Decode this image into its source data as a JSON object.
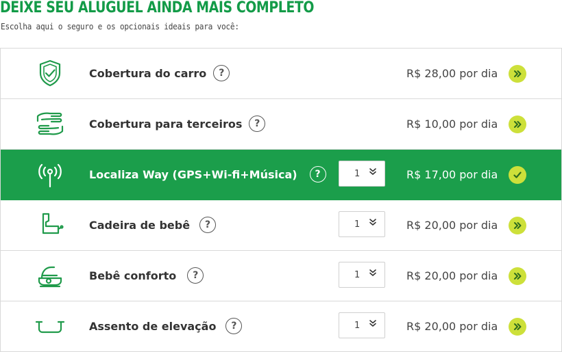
{
  "heading": "DEIXE SEU ALUGUEL AINDA MAIS COMPLETO",
  "subheading": "Escolha aqui o seguro e os opcionais ideais para você:",
  "colors": {
    "brand_green": "#139b48",
    "selected_row": "#1b9e4b",
    "action_button": "#cde03a"
  },
  "help_symbol": "?",
  "options": [
    {
      "icon": "shield-check-icon",
      "label": "Cobertura do carro",
      "price": "R$ 28,00 por dia",
      "selected": false,
      "action_icon": "double-chevron-right-icon"
    },
    {
      "icon": "hands-icon",
      "label": "Cobertura para terceiros",
      "price": "R$ 10,00 por dia",
      "selected": false,
      "action_icon": "double-chevron-right-icon"
    },
    {
      "icon": "wifi-antenna-icon",
      "label": "Localiza Way (GPS+Wi-fi+Música)",
      "quantity": "1",
      "price": "R$ 17,00 por dia",
      "selected": true,
      "action_icon": "checkmark-icon"
    },
    {
      "icon": "baby-seat-icon",
      "label": "Cadeira de bebê",
      "quantity": "1",
      "price": "R$ 20,00 por dia",
      "selected": false,
      "action_icon": "double-chevron-right-icon"
    },
    {
      "icon": "baby-carrier-icon",
      "label": "Bebê conforto",
      "quantity": "1",
      "price": "R$ 20,00 por dia",
      "selected": false,
      "action_icon": "double-chevron-right-icon"
    },
    {
      "icon": "booster-seat-icon",
      "label": "Assento de elevação",
      "quantity": "1",
      "price": "R$ 20,00 por dia",
      "selected": false,
      "action_icon": "double-chevron-right-icon"
    }
  ]
}
